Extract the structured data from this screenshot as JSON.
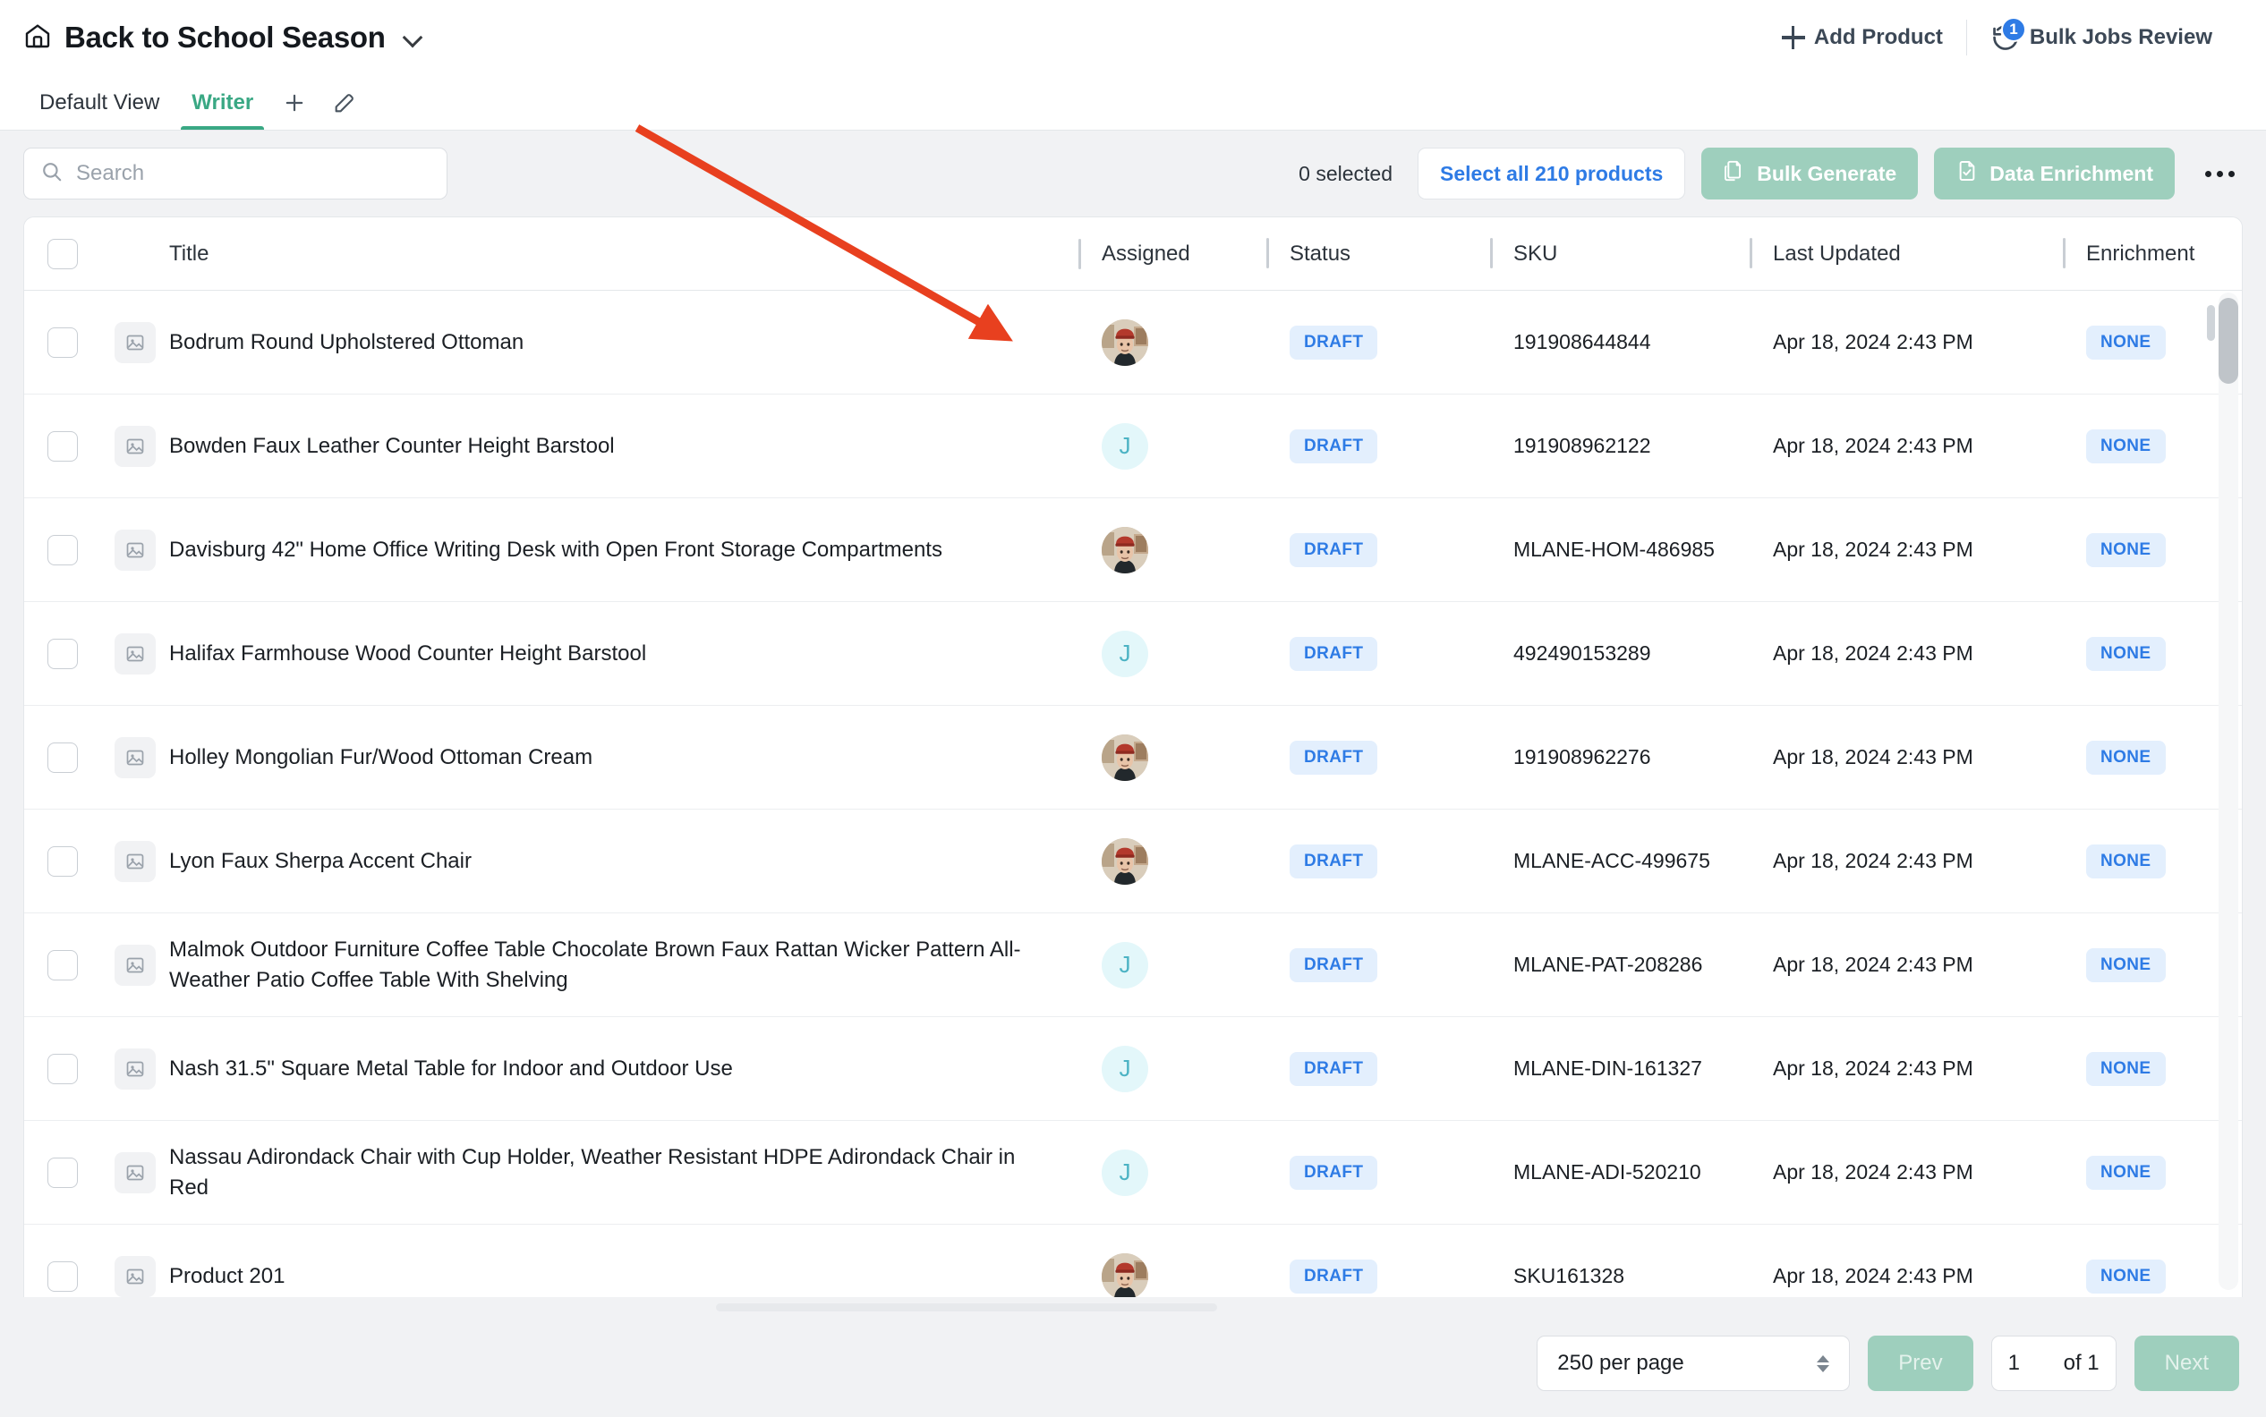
{
  "header": {
    "title": "Back to School Season",
    "home_icon": "home-icon",
    "chevron_icon": "chevron-down-icon",
    "add_product_label": "Add Product",
    "bulk_jobs_label": "Bulk Jobs Review",
    "bulk_jobs_badge": "1"
  },
  "tabs": [
    {
      "label": "Default View",
      "active": false
    },
    {
      "label": "Writer",
      "active": true
    }
  ],
  "tab_actions": {
    "add_icon": "plus-icon",
    "edit_icon": "pencil-icon"
  },
  "toolbar": {
    "search_placeholder": "Search",
    "search_value": "",
    "selected_text": "0 selected",
    "select_all_label": "Select all 210 products",
    "bulk_generate_label": "Bulk Generate",
    "data_enrichment_label": "Data Enrichment",
    "more_icon": "more-horizontal-icon"
  },
  "table": {
    "columns": [
      "Title",
      "Assigned",
      "Status",
      "SKU",
      "Last Updated",
      "Enrichment"
    ],
    "rows": [
      {
        "title": "Bodrum Round Upholstered Ottoman",
        "assigned_type": "photo",
        "assigned_initial": "",
        "status": "DRAFT",
        "sku": "191908644844",
        "updated": "Apr 18, 2024 2:43 PM",
        "enrichment": "NONE"
      },
      {
        "title": "Bowden Faux Leather Counter Height Barstool",
        "assigned_type": "letter",
        "assigned_initial": "J",
        "status": "DRAFT",
        "sku": "191908962122",
        "updated": "Apr 18, 2024 2:43 PM",
        "enrichment": "NONE"
      },
      {
        "title": "Davisburg 42\" Home Office Writing Desk with Open Front Storage Compartments",
        "assigned_type": "photo",
        "assigned_initial": "",
        "status": "DRAFT",
        "sku": "MLANE-HOM-486985",
        "updated": "Apr 18, 2024 2:43 PM",
        "enrichment": "NONE"
      },
      {
        "title": "Halifax Farmhouse Wood Counter Height Barstool",
        "assigned_type": "letter",
        "assigned_initial": "J",
        "status": "DRAFT",
        "sku": "492490153289",
        "updated": "Apr 18, 2024 2:43 PM",
        "enrichment": "NONE"
      },
      {
        "title": "Holley Mongolian Fur/Wood Ottoman Cream",
        "assigned_type": "photo",
        "assigned_initial": "",
        "status": "DRAFT",
        "sku": "191908962276",
        "updated": "Apr 18, 2024 2:43 PM",
        "enrichment": "NONE"
      },
      {
        "title": "Lyon Faux Sherpa Accent Chair",
        "assigned_type": "photo",
        "assigned_initial": "",
        "status": "DRAFT",
        "sku": "MLANE-ACC-499675",
        "updated": "Apr 18, 2024 2:43 PM",
        "enrichment": "NONE"
      },
      {
        "title": "Malmok Outdoor Furniture Coffee Table Chocolate Brown Faux Rattan Wicker Pattern All-Weather Patio Coffee Table With Shelving",
        "assigned_type": "letter",
        "assigned_initial": "J",
        "status": "DRAFT",
        "sku": "MLANE-PAT-208286",
        "updated": "Apr 18, 2024 2:43 PM",
        "enrichment": "NONE"
      },
      {
        "title": "Nash 31.5\" Square Metal Table for Indoor and Outdoor Use",
        "assigned_type": "letter",
        "assigned_initial": "J",
        "status": "DRAFT",
        "sku": "MLANE-DIN-161327",
        "updated": "Apr 18, 2024 2:43 PM",
        "enrichment": "NONE"
      },
      {
        "title": "Nassau Adirondack Chair with Cup Holder, Weather Resistant HDPE Adirondack Chair in Red",
        "assigned_type": "letter",
        "assigned_initial": "J",
        "status": "DRAFT",
        "sku": "MLANE-ADI-520210",
        "updated": "Apr 18, 2024 2:43 PM",
        "enrichment": "NONE"
      },
      {
        "title": "Product 201",
        "assigned_type": "photo",
        "assigned_initial": "",
        "status": "DRAFT",
        "sku": "SKU161328",
        "updated": "Apr 18, 2024 2:43 PM",
        "enrichment": "NONE"
      }
    ]
  },
  "pagination": {
    "per_page_label": "250 per page",
    "prev_label": "Prev",
    "next_label": "Next",
    "page_value": "1",
    "of_label": "of 1"
  },
  "annotation": {
    "arrow_color": "#e8401f"
  },
  "colors": {
    "accent_green": "#3aa884",
    "button_green": "#9ecfbd",
    "link_blue": "#2e7be5",
    "badge_blue_bg": "#e3effd",
    "avatar_cyan_bg": "#e3f7fa",
    "avatar_cyan_fg": "#4cb3c4"
  }
}
